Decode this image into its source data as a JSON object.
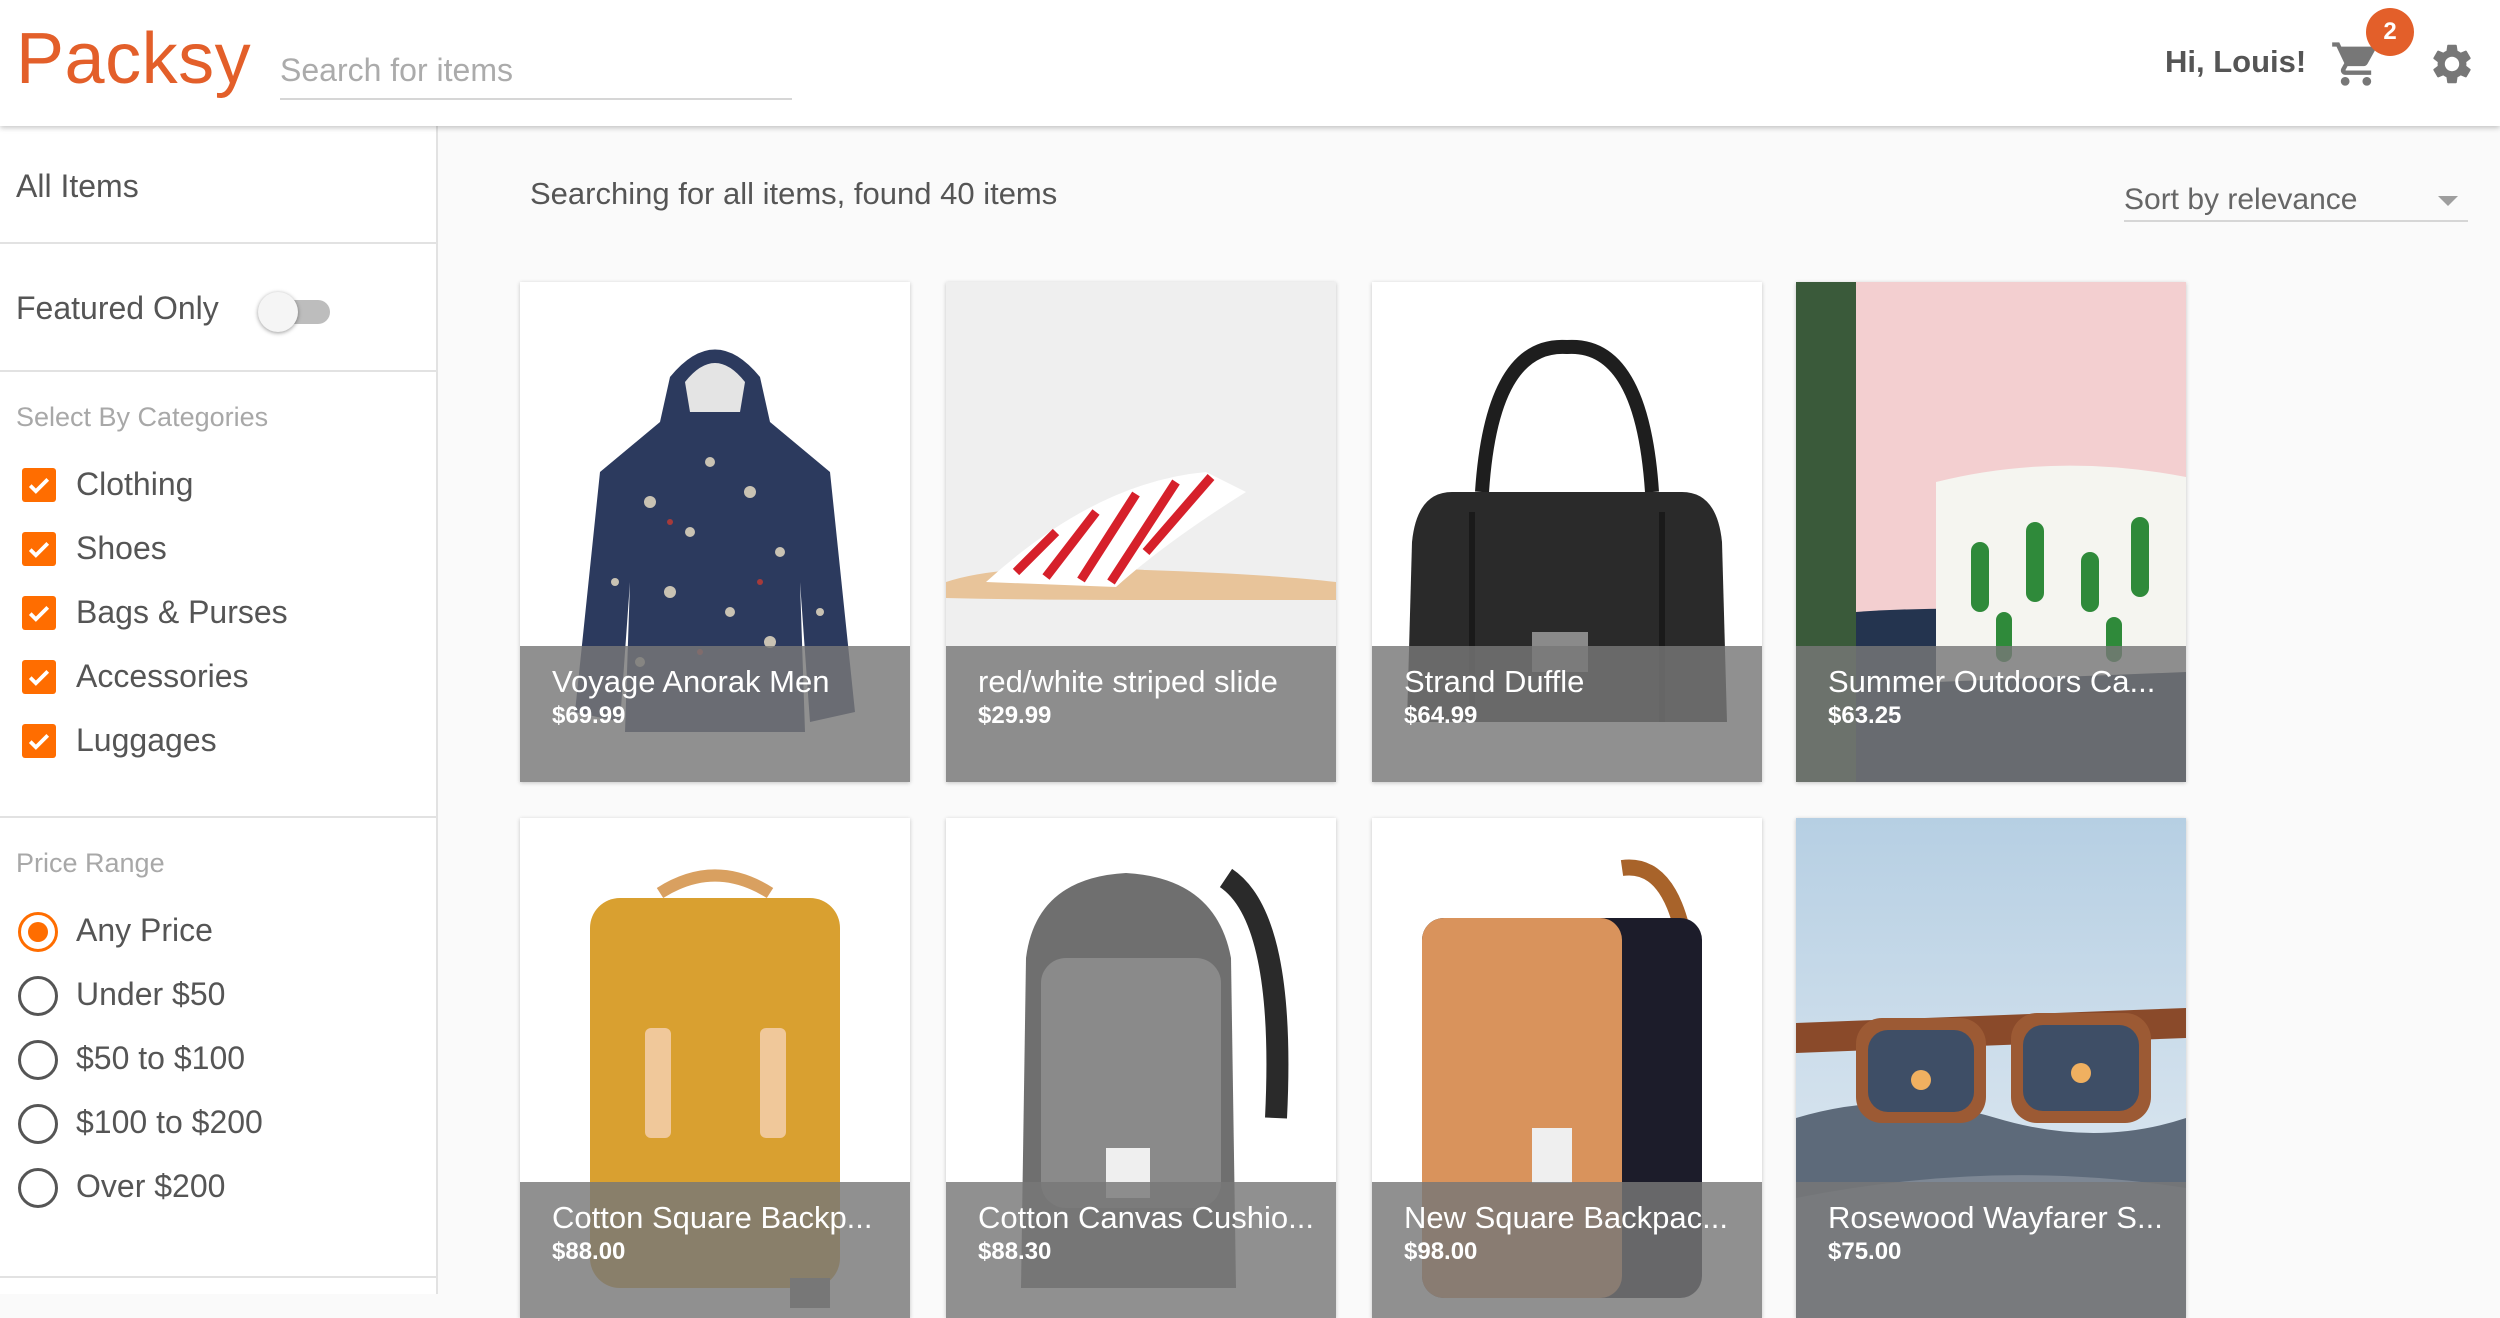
{
  "header": {
    "logo": "Packsy",
    "search_placeholder": "Search for items",
    "greeting": "Hi, Louis!",
    "cart_count": "2",
    "icons": {
      "cart": "shopping-cart-icon",
      "settings": "gear-icon"
    },
    "accent_color": "#e35f2a"
  },
  "sidebar": {
    "all_items": "All Items",
    "featured_label": "Featured Only",
    "featured_on": false,
    "categories_heading": "Select By Categories",
    "categories": [
      {
        "label": "Clothing",
        "checked": true
      },
      {
        "label": "Shoes",
        "checked": true
      },
      {
        "label": "Bags & Purses",
        "checked": true
      },
      {
        "label": "Accessories",
        "checked": true
      },
      {
        "label": "Luggages",
        "checked": true
      }
    ],
    "price_heading": "Price Range",
    "price_options": [
      {
        "label": "Any Price",
        "selected": true
      },
      {
        "label": "Under $50",
        "selected": false
      },
      {
        "label": "$50 to $100",
        "selected": false
      },
      {
        "label": "$100 to $200",
        "selected": false
      },
      {
        "label": "Over $200",
        "selected": false
      }
    ],
    "checkbox_color": "#ff6d00"
  },
  "main": {
    "result_text": "Searching for all items, found 40 items",
    "sort_label": "Sort by relevance",
    "products": [
      {
        "title": "Voyage Anorak Men",
        "price": "$69.99"
      },
      {
        "title": "red/white striped slide",
        "price": "$29.99"
      },
      {
        "title": "Strand Duffle",
        "price": "$64.99"
      },
      {
        "title": "Summer Outdoors Ca...",
        "price": "$63.25"
      },
      {
        "title": "Cotton Square Backp...",
        "price": "$88.00"
      },
      {
        "title": "Cotton Canvas Cushio...",
        "price": "$88.30"
      },
      {
        "title": "New Square Backpac...",
        "price": "$98.00"
      },
      {
        "title": "Rosewood Wayfarer S...",
        "price": "$75.00"
      }
    ]
  }
}
